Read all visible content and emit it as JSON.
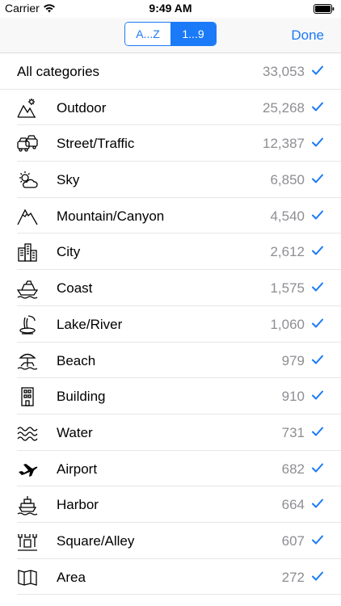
{
  "status_bar": {
    "carrier": "Carrier",
    "time": "9:49 AM"
  },
  "nav": {
    "segments": [
      {
        "label": "A...Z",
        "selected": false
      },
      {
        "label": "1...9",
        "selected": true
      }
    ],
    "done_label": "Done"
  },
  "colors": {
    "accent": "#1a7af8",
    "count": "#8e8e93"
  },
  "rows": [
    {
      "label": "All categories",
      "count": "33,053",
      "icon": "",
      "checked": true
    },
    {
      "label": "Outdoor",
      "count": "25,268",
      "icon": "outdoor-mountains-sun-icon",
      "checked": true
    },
    {
      "label": "Street/Traffic",
      "count": "12,387",
      "icon": "cars-traffic-icon",
      "checked": true
    },
    {
      "label": "Sky",
      "count": "6,850",
      "icon": "sun-cloud-icon",
      "checked": true
    },
    {
      "label": "Mountain/Canyon",
      "count": "4,540",
      "icon": "mountain-icon",
      "checked": true
    },
    {
      "label": "City",
      "count": "2,612",
      "icon": "city-buildings-icon",
      "checked": true
    },
    {
      "label": "Coast",
      "count": "1,575",
      "icon": "ship-coast-icon",
      "checked": true
    },
    {
      "label": "Lake/River",
      "count": "1,060",
      "icon": "waterfall-icon",
      "checked": true
    },
    {
      "label": "Beach",
      "count": "979",
      "icon": "beach-umbrella-icon",
      "checked": true
    },
    {
      "label": "Building",
      "count": "910",
      "icon": "building-icon",
      "checked": true
    },
    {
      "label": "Water",
      "count": "731",
      "icon": "waves-icon",
      "checked": true
    },
    {
      "label": "Airport",
      "count": "682",
      "icon": "airplane-icon",
      "checked": true
    },
    {
      "label": "Harbor",
      "count": "664",
      "icon": "harbor-ship-icon",
      "checked": true
    },
    {
      "label": "Square/Alley",
      "count": "607",
      "icon": "square-alley-icon",
      "checked": true
    },
    {
      "label": "Area",
      "count": "272",
      "icon": "area-map-icon",
      "checked": true
    }
  ]
}
